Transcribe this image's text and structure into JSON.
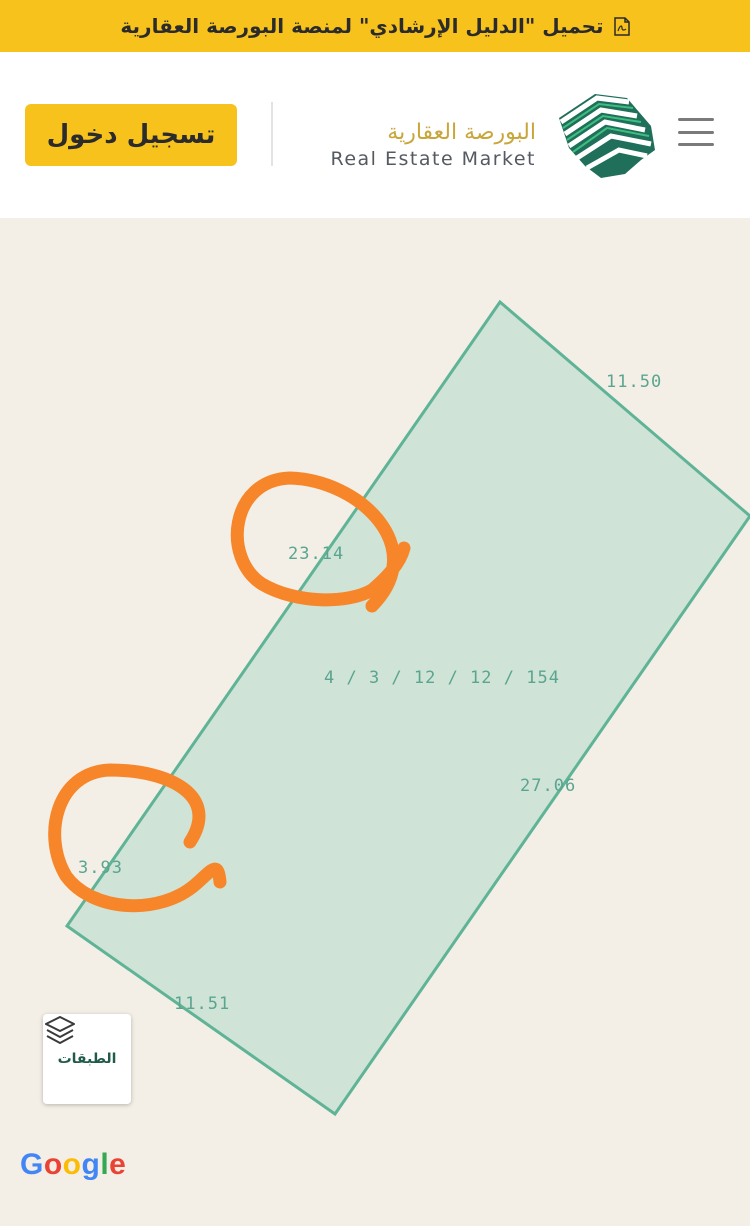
{
  "banner": {
    "text": "تحميل \"الدليل الإرشادي\" لمنصة البورصة العقارية",
    "icon": "pdf-file-icon"
  },
  "header": {
    "login_label": "تسجيل دخول",
    "logo_ar": "البورصة العقارية",
    "logo_en": "Real Estate Market",
    "logo_icon": "saudi-map-logo-icon",
    "menu_icon": "hamburger-menu-icon"
  },
  "map": {
    "parcel_id": "4 / 3 / 12 / 12 / 154",
    "dimensions": {
      "top": "11.50",
      "left_upper": "23.14",
      "right": "27.06",
      "left_lower": "3.93",
      "bottom": "11.51"
    },
    "layers_label": "الطبقات",
    "layers_icon": "layers-icon",
    "google": [
      "G",
      "o",
      "o",
      "g",
      "l",
      "e"
    ]
  },
  "colors": {
    "banner": "#f8c21d",
    "parcel_fill": "#c9e0d4",
    "parcel_stroke": "#5fb396",
    "annotation": "#f7862a",
    "map_bg": "#f3efe7"
  }
}
